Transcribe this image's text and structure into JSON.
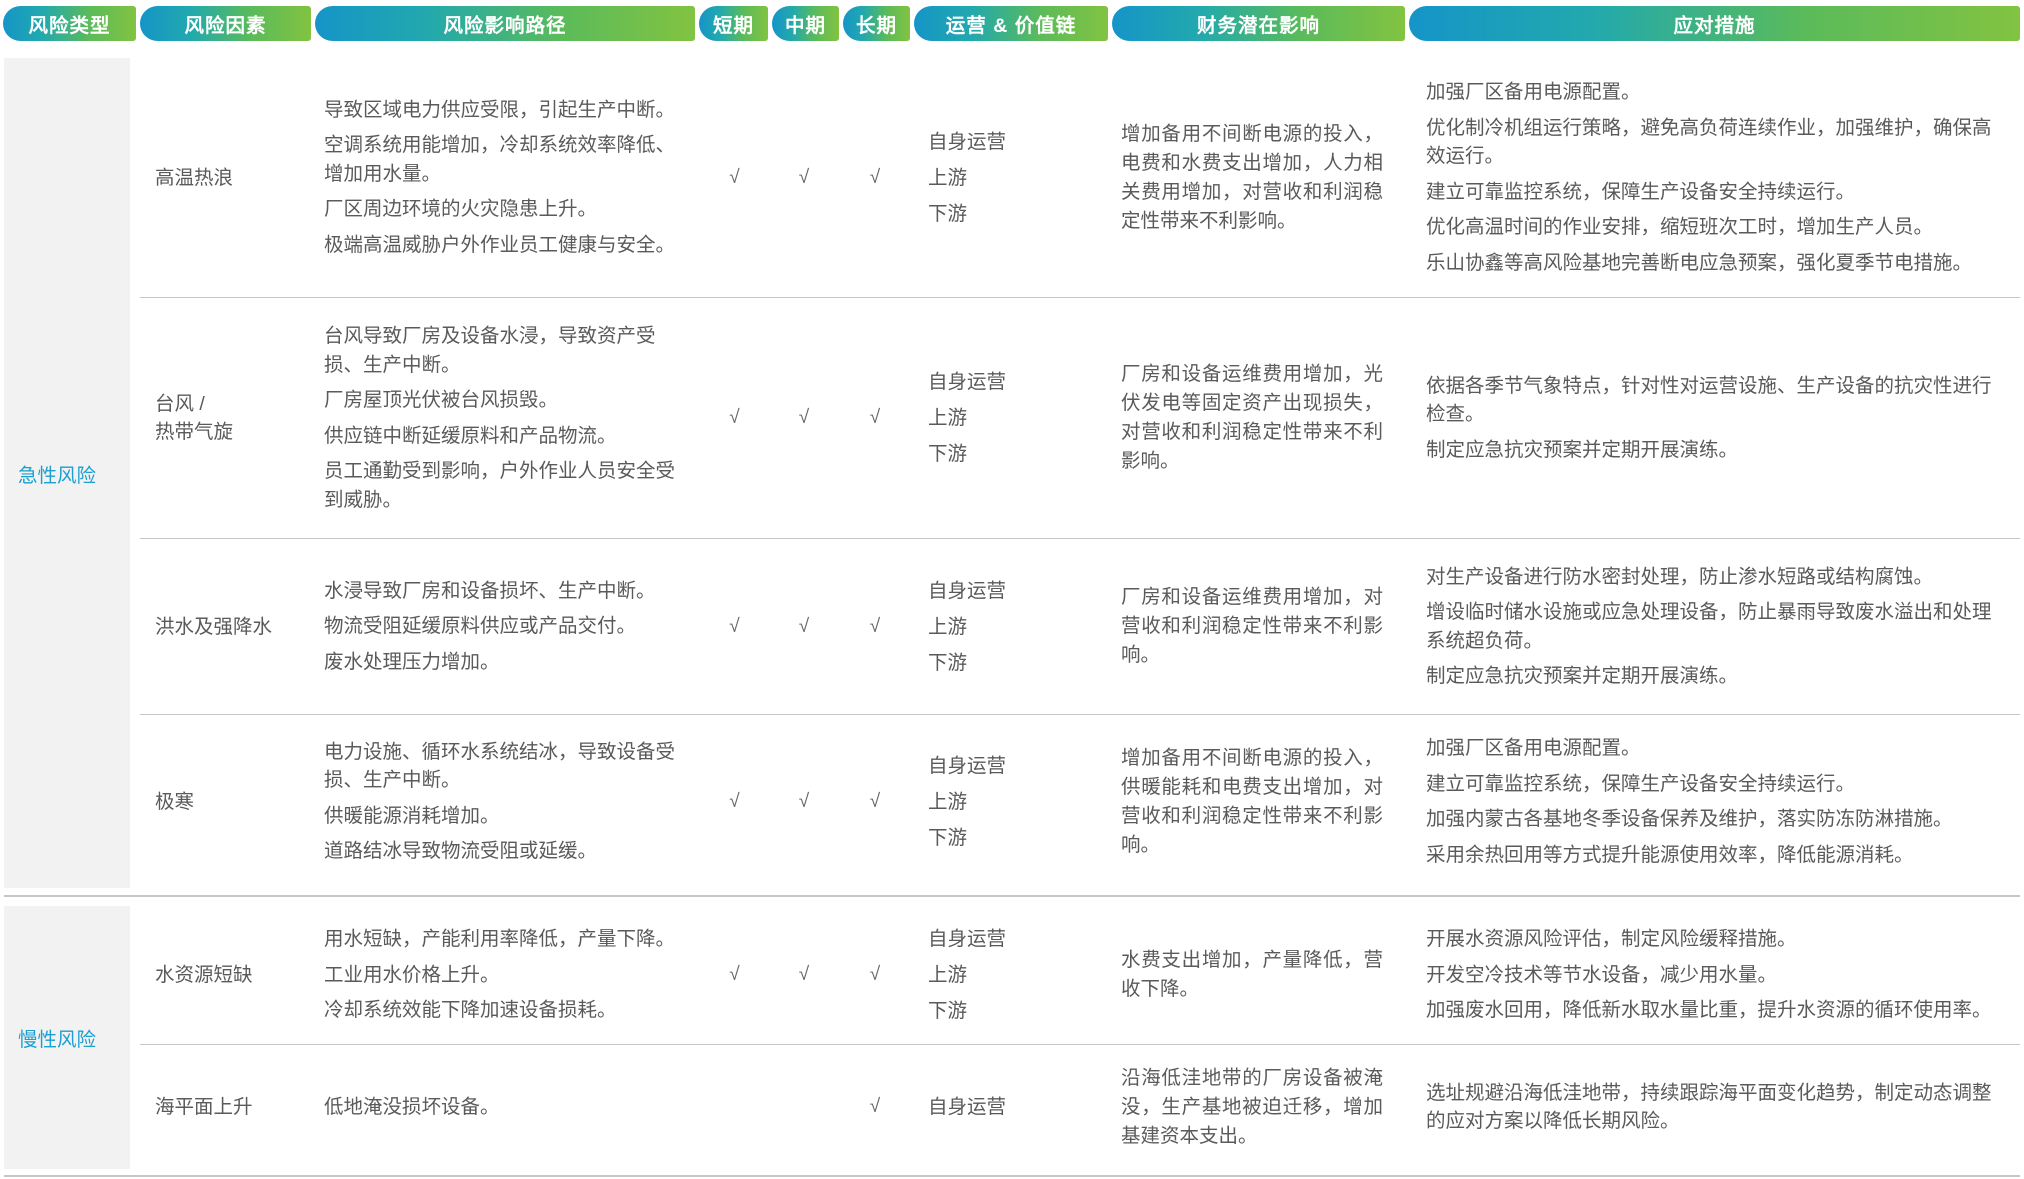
{
  "header": {
    "columns": [
      "风险类型",
      "风险因素",
      "风险影响路径",
      "短期",
      "中期",
      "长期",
      "运营 & 价值链",
      "财务潜在影响",
      "应对措施"
    ]
  },
  "colors": {
    "header_gradient_start": "#1595c8",
    "header_gradient_end": "#82c341",
    "category_text": "#1c9fd0",
    "category_bg": "#f2f2f2",
    "body_text": "#5a5a5a"
  },
  "groups": [
    {
      "category": "急性风险",
      "rows": [
        {
          "factor": "高温热浪",
          "paths": [
            "导致区域电力供应受限，引起生产中断。",
            "空调系统用能增加，冷却系统效率降低、增加用水量。",
            "厂区周边环境的火灾隐患上升。",
            "极端高温威胁户外作业员工健康与安全。"
          ],
          "terms": [
            "√",
            "√",
            "√"
          ],
          "chain": [
            "自身运营",
            "上游",
            "下游"
          ],
          "finance": "增加备用不间断电源的投入，电费和水费支出增加，人力相关费用增加，对营收和利润稳定性带来不利影响。",
          "measures": [
            "加强厂区备用电源配置。",
            "优化制冷机组运行策略，避免高负荷连续作业，加强维护，确保高效运行。",
            "建立可靠监控系统，保障生产设备安全持续运行。",
            "优化高温时间的作业安排，缩短班次工时，增加生产人员。",
            "乐山协鑫等高风险基地完善断电应急预案，强化夏季节电措施。"
          ]
        },
        {
          "factor": "台风 /\n热带气旋",
          "paths": [
            "台风导致厂房及设备水浸，导致资产受损、生产中断。",
            "厂房屋顶光伏被台风损毁。",
            "供应链中断延缓原料和产品物流。",
            "员工通勤受到影响，户外作业人员安全受到威胁。"
          ],
          "terms": [
            "√",
            "√",
            "√"
          ],
          "chain": [
            "自身运营",
            "上游",
            "下游"
          ],
          "finance": "厂房和设备运维费用增加，光伏发电等固定资产出现损失，对营收和利润稳定性带来不利影响。",
          "measures": [
            "依据各季节气象特点，针对性对运营设施、生产设备的抗灾性进行检查。",
            "制定应急抗灾预案并定期开展演练。"
          ]
        },
        {
          "factor": "洪水及强降水",
          "paths": [
            "水浸导致厂房和设备损坏、生产中断。",
            "物流受阻延缓原料供应或产品交付。",
            "废水处理压力增加。"
          ],
          "terms": [
            "√",
            "√",
            "√"
          ],
          "chain": [
            "自身运营",
            "上游",
            "下游"
          ],
          "finance": "厂房和设备运维费用增加，对营收和利润稳定性带来不利影响。",
          "measures": [
            "对生产设备进行防水密封处理，防止渗水短路或结构腐蚀。",
            "增设临时储水设施或应急处理设备，防止暴雨导致废水溢出和处理系统超负荷。",
            "制定应急抗灾预案并定期开展演练。"
          ]
        },
        {
          "factor": "极寒",
          "paths": [
            "电力设施、循环水系统结冰，导致设备受损、生产中断。",
            "供暖能源消耗增加。",
            "道路结冰导致物流受阻或延缓。"
          ],
          "terms": [
            "√",
            "√",
            "√"
          ],
          "chain": [
            "自身运营",
            "上游",
            "下游"
          ],
          "finance": "增加备用不间断电源的投入，供暖能耗和电费支出增加，对营收和利润稳定性带来不利影响。",
          "measures": [
            "加强厂区备用电源配置。",
            "建立可靠监控系统，保障生产设备安全持续运行。",
            "加强内蒙古各基地冬季设备保养及维护，落实防冻防淋措施。",
            "采用余热回用等方式提升能源使用效率，降低能源消耗。"
          ]
        }
      ]
    },
    {
      "category": "慢性风险",
      "rows": [
        {
          "factor": "水资源短缺",
          "paths": [
            "用水短缺，产能利用率降低，产量下降。",
            "工业用水价格上升。",
            "冷却系统效能下降加速设备损耗。"
          ],
          "terms": [
            "√",
            "√",
            "√"
          ],
          "chain": [
            "自身运营",
            "上游",
            "下游"
          ],
          "finance": "水费支出增加，产量降低，营收下降。",
          "measures": [
            "开展水资源风险评估，制定风险缓释措施。",
            "开发空冷技术等节水设备，减少用水量。",
            "加强废水回用，降低新水取水量比重，提升水资源的循环使用率。"
          ]
        },
        {
          "factor": "海平面上升",
          "paths": [
            "低地淹没损坏设备。"
          ],
          "terms": [
            "",
            "",
            "√"
          ],
          "chain": [
            "自身运营"
          ],
          "finance": "沿海低洼地带的厂房设备被淹没，生产基地被迫迁移，增加基建资本支出。",
          "measures": [
            "选址规避沿海低洼地带，持续跟踪海平面变化趋势，制定动态调整的应对方案以降低长期风险。"
          ]
        }
      ]
    }
  ]
}
